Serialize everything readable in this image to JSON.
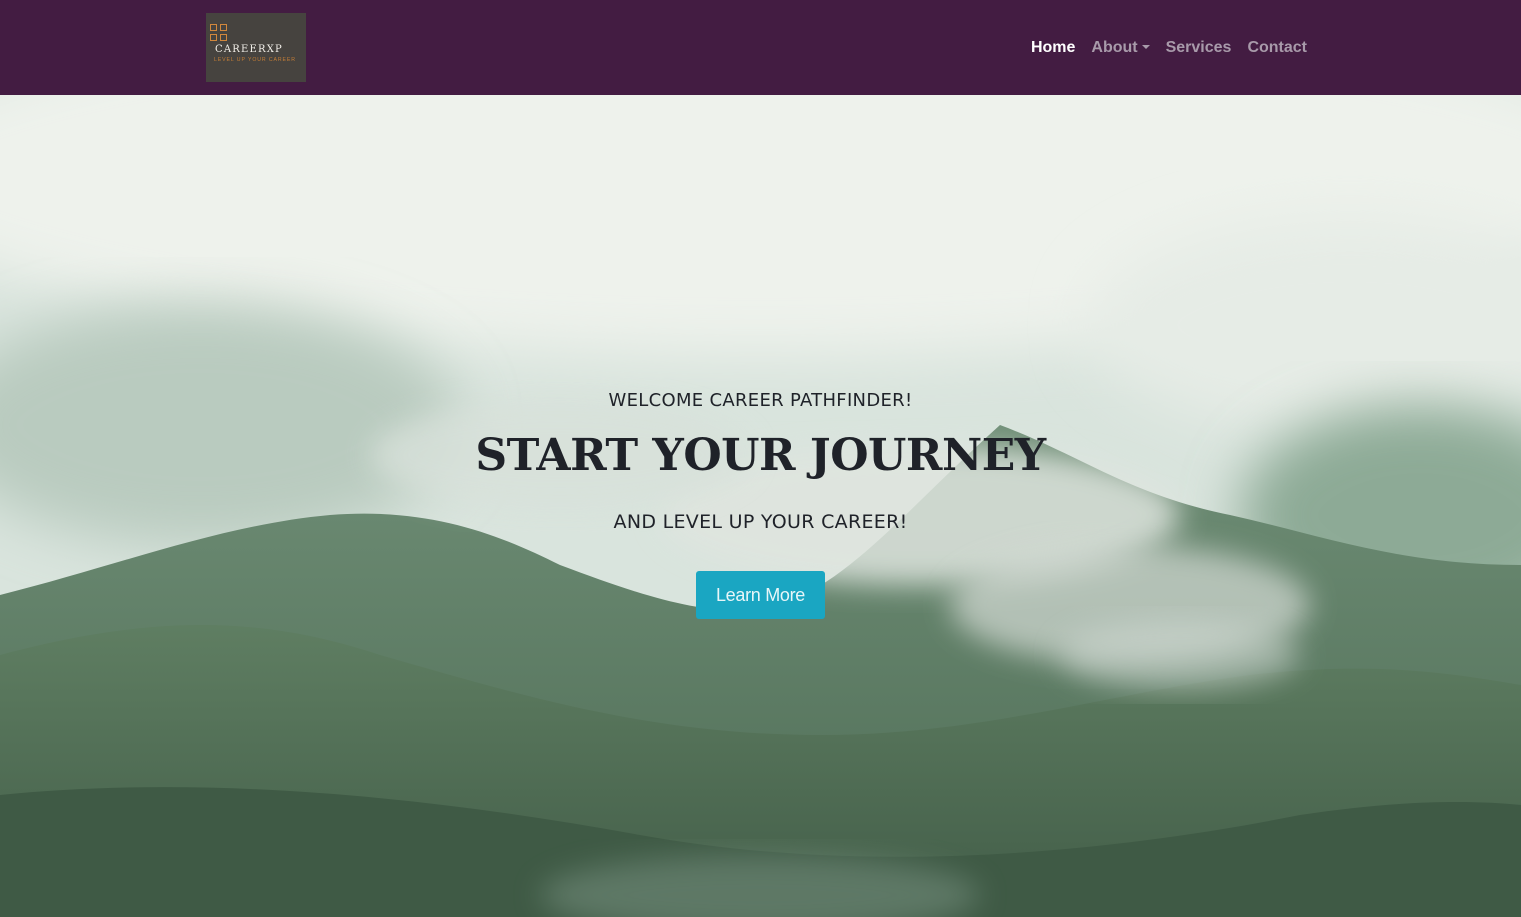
{
  "logo": {
    "name": "CAREERXP",
    "tagline": "LEVEL UP YOUR CAREER"
  },
  "nav": {
    "items": [
      {
        "label": "Home"
      },
      {
        "label": "About"
      },
      {
        "label": "Services"
      },
      {
        "label": "Contact"
      }
    ]
  },
  "hero": {
    "welcome": "WELCOME CAREER PATHFINDER!",
    "headline": "START YOUR JOURNEY",
    "subheadline": "AND LEVEL UP YOUR CAREER!",
    "button_label": "Learn More"
  },
  "colors": {
    "navbar_bg": "#431c42",
    "nav_active": "#ffffff",
    "nav_inactive": "#a89aaa",
    "button_bg": "#1aa6c2",
    "logo_accent": "#d2873c"
  }
}
